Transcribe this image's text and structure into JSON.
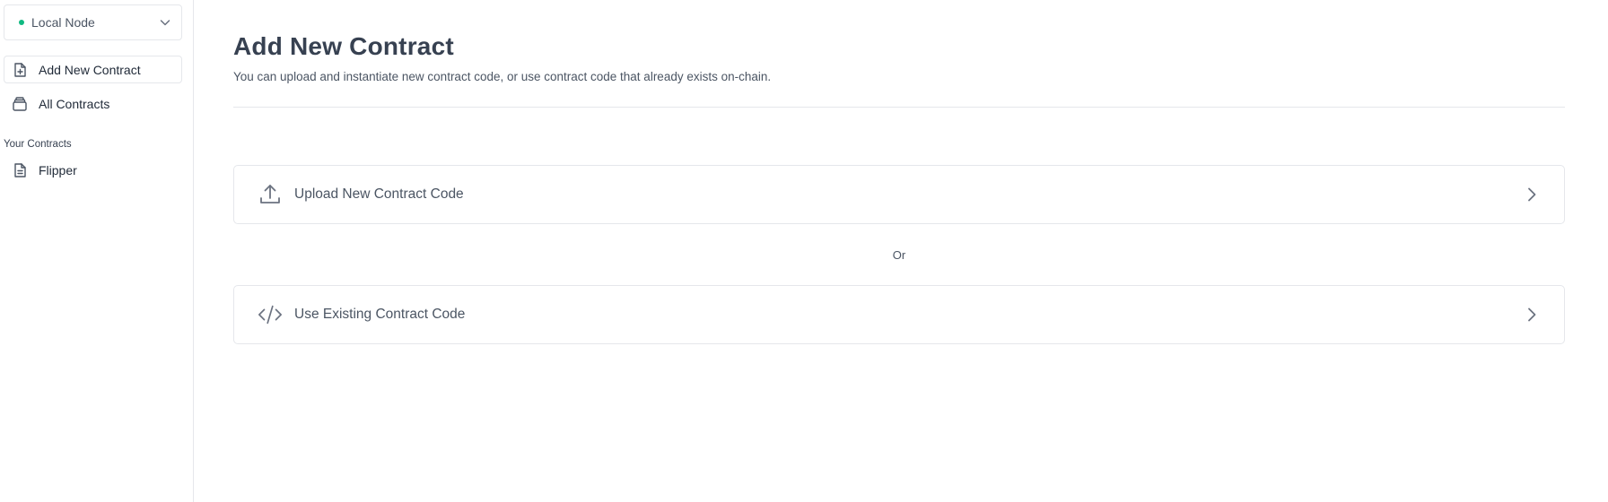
{
  "sidebar": {
    "node_selector": {
      "label": "Local Node",
      "status_color": "#10b981",
      "icon": "chevron-down-icon"
    },
    "nav": [
      {
        "label": "Add New Contract",
        "icon": "file-plus-icon",
        "active": true
      },
      {
        "label": "All Contracts",
        "icon": "stack-icon",
        "active": false
      }
    ],
    "your_contracts": {
      "heading": "Your Contracts",
      "items": [
        {
          "label": "Flipper",
          "icon": "document-icon"
        }
      ]
    }
  },
  "main": {
    "title": "Add New Contract",
    "subtitle": "You can upload and instantiate new contract code, or use contract code that already exists on-chain.",
    "options": [
      {
        "label": "Upload New Contract Code",
        "icon": "upload-icon"
      },
      {
        "label": "Use Existing Contract Code",
        "icon": "code-icon"
      }
    ],
    "separator": "Or"
  }
}
